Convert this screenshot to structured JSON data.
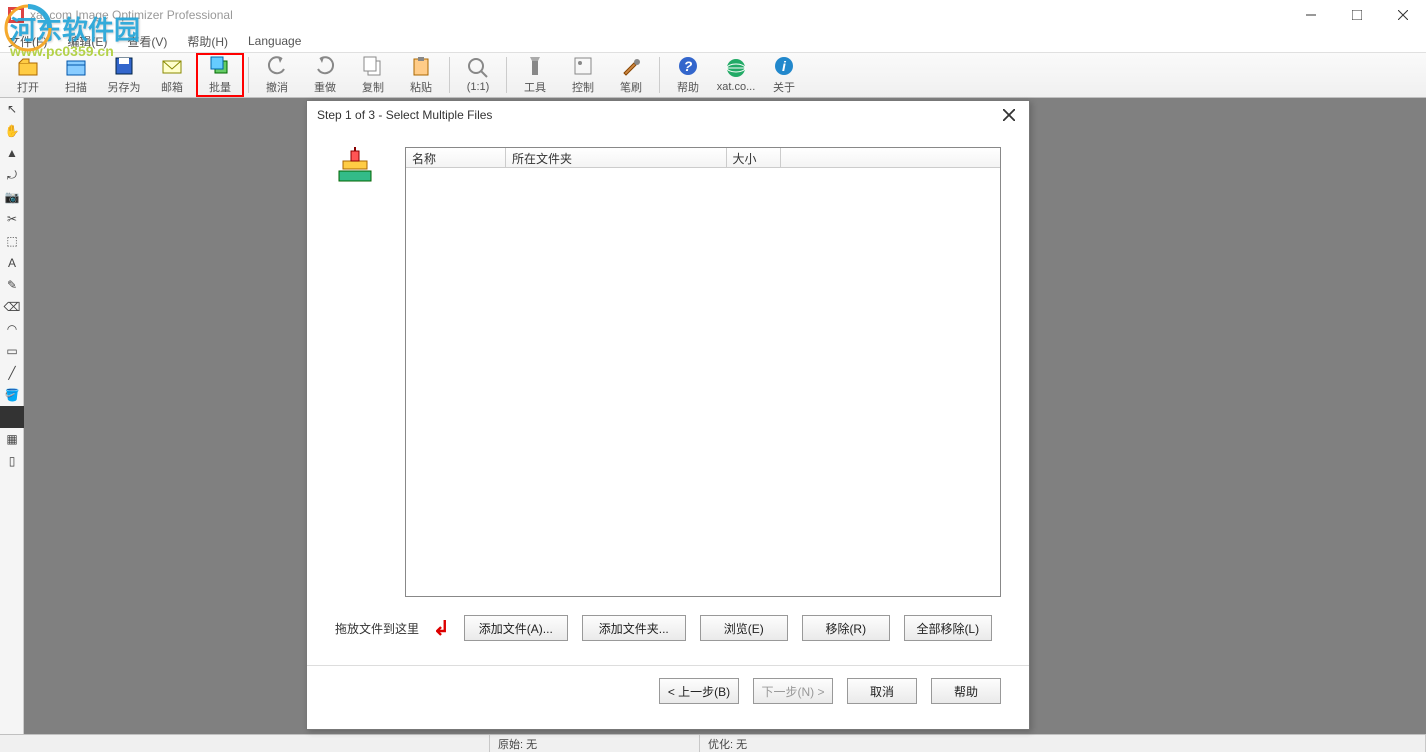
{
  "window": {
    "title": "xat.com  Image Optimizer Professional"
  },
  "menubar": {
    "items": [
      "文件(F)",
      "编辑(E)",
      "查看(V)",
      "帮助(H)",
      "Language"
    ]
  },
  "toolbar": {
    "items": [
      {
        "label": "打开",
        "icon": "open"
      },
      {
        "label": "扫描",
        "icon": "scan"
      },
      {
        "label": "另存为",
        "icon": "saveas"
      },
      {
        "label": "邮箱",
        "icon": "mail"
      },
      {
        "label": "批量",
        "icon": "batch",
        "highlighted": true
      },
      {
        "sep": true
      },
      {
        "label": "撤消",
        "icon": "undo"
      },
      {
        "label": "重做",
        "icon": "redo"
      },
      {
        "label": "复制",
        "icon": "copy"
      },
      {
        "label": "粘贴",
        "icon": "paste"
      },
      {
        "sep": true
      },
      {
        "label": "(1:1)",
        "icon": "zoom11"
      },
      {
        "sep": true
      },
      {
        "label": "工具",
        "icon": "tools"
      },
      {
        "label": "控制",
        "icon": "control"
      },
      {
        "label": "笔刷",
        "icon": "brush"
      },
      {
        "sep": true
      },
      {
        "label": "帮助",
        "icon": "help"
      },
      {
        "label": "xat.co...",
        "icon": "web"
      },
      {
        "label": "关于",
        "icon": "about"
      }
    ]
  },
  "dialog": {
    "title": "Step 1 of 3 - Select Multiple Files",
    "columns": {
      "name": "名称",
      "folder": "所在文件夹",
      "size": "大小"
    },
    "drop_label": "拖放文件到这里",
    "buttons": {
      "add_file": "添加文件(A)...",
      "add_folder": "添加文件夹...",
      "browse": "浏览(E)",
      "remove": "移除(R)",
      "remove_all": "全部移除(L)"
    },
    "footer": {
      "back": "< 上一步(B)",
      "next": "下一步(N) >",
      "cancel": "取消",
      "help": "帮助"
    }
  },
  "statusbar": {
    "original": "原始: 无",
    "optimized": "优化: 无"
  },
  "watermark": {
    "text": "河东软件园",
    "url": "www.pc0359.cn"
  }
}
